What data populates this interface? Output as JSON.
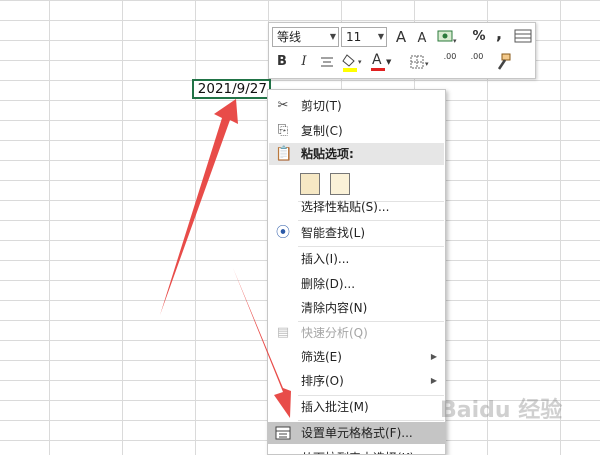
{
  "cell": {
    "value": "2021/9/27"
  },
  "toolbar": {
    "font_name": "等线",
    "font_size": "11",
    "grow_font": "A",
    "shrink_font": "A",
    "percent": "%",
    "comma": ",",
    "bold": "B",
    "italic": "I",
    "font_color": "A",
    "increase_decimal": ".00",
    "decrease_decimal": ".00"
  },
  "menu": {
    "cut": "剪切(T)",
    "copy": "复制(C)",
    "paste_header": "粘贴选项:",
    "paste_special": "选择性粘贴(S)...",
    "smart_lookup": "智能查找(L)",
    "insert": "插入(I)...",
    "delete": "删除(D)...",
    "clear": "清除内容(N)",
    "quick_analysis": "快速分析(Q)",
    "filter": "筛选(E)",
    "sort": "排序(O)",
    "insert_comment": "插入批注(M)",
    "format_cells": "设置单元格格式(F)...",
    "pick_from_list": "从下拉列表中选择(K)..."
  },
  "colors": {
    "accent": "#217346",
    "arrow": "#e53935",
    "highlight": "#c5c5c5"
  },
  "watermark": "Baidu 经验"
}
